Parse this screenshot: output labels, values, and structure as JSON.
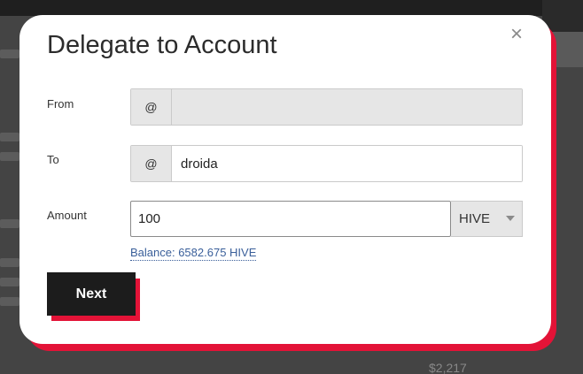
{
  "modal": {
    "title": "Delegate to Account",
    "close_glyph": "×"
  },
  "form": {
    "from": {
      "label": "From",
      "prefix": "@",
      "value": ""
    },
    "to": {
      "label": "To",
      "prefix": "@",
      "value": "droida"
    },
    "amount": {
      "label": "Amount",
      "value": "100"
    },
    "asset": {
      "selected": "HIVE"
    },
    "balance_text": "Balance: 6582.675 HIVE",
    "next_label": "Next"
  },
  "background": {
    "price_text": "$2,217"
  },
  "colors": {
    "accent": "#e31337",
    "button": "#1c1c1c",
    "link": "#3a5f9a"
  },
  "icons": {
    "close": "close-icon",
    "dropdown": "chevron-down-icon"
  }
}
